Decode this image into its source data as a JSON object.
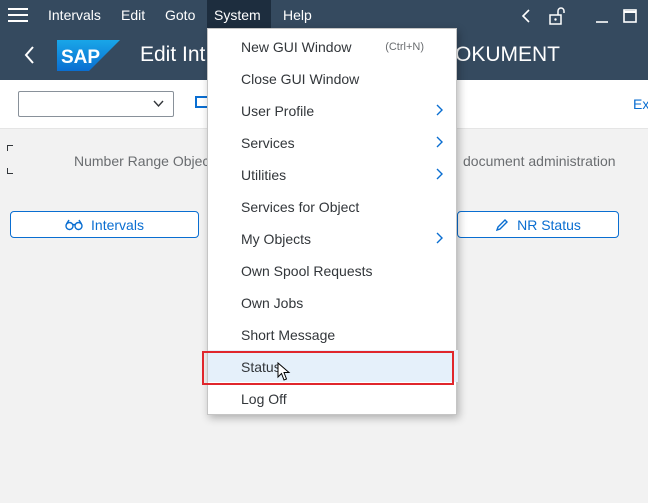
{
  "menubar": {
    "items": [
      {
        "label": "Intervals"
      },
      {
        "label": "Edit"
      },
      {
        "label": "Goto"
      },
      {
        "label": "System"
      },
      {
        "label": "Help"
      }
    ],
    "active_item": "System"
  },
  "header": {
    "logo_text": "SAP",
    "title_left": "Edit Int",
    "title_right": "OKUMENT"
  },
  "toolbar": {
    "select_value": "",
    "overflow_label": "Ex"
  },
  "content": {
    "nr_object_label": "Number Range Object",
    "nr_object_description": "document administration",
    "intervals_button": "Intervals",
    "nr_status_button": "NR Status"
  },
  "system_menu": {
    "items": [
      {
        "label": "New GUI Window",
        "shortcut": "(Ctrl+N)",
        "submenu": false
      },
      {
        "label": "Close GUI Window",
        "shortcut": "",
        "submenu": false
      },
      {
        "label": "User Profile",
        "shortcut": "",
        "submenu": true
      },
      {
        "label": "Services",
        "shortcut": "",
        "submenu": true
      },
      {
        "label": "Utilities",
        "shortcut": "",
        "submenu": true
      },
      {
        "label": "Services for Object",
        "shortcut": "",
        "submenu": false
      },
      {
        "label": "My Objects",
        "shortcut": "",
        "submenu": true
      },
      {
        "label": "Own Spool Requests",
        "shortcut": "",
        "submenu": false
      },
      {
        "label": "Own Jobs",
        "shortcut": "",
        "submenu": false
      },
      {
        "label": "Short Message",
        "shortcut": "",
        "submenu": false
      },
      {
        "label": "Status",
        "shortcut": "",
        "submenu": false
      },
      {
        "label": "Log Off",
        "shortcut": "",
        "submenu": false
      }
    ],
    "highlighted_item": "Status"
  },
  "colors": {
    "shell": "#354a5f",
    "accent": "#0a6ed1",
    "highlight_border": "#e0262c"
  }
}
